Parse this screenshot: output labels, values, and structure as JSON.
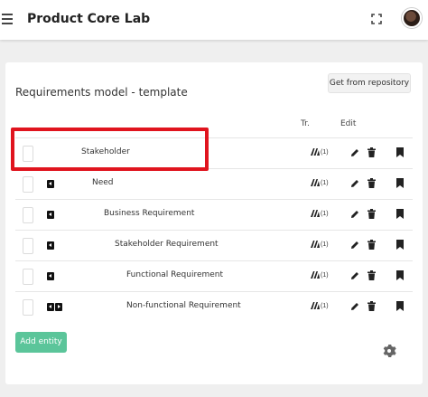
{
  "header": {
    "app_title": "Product Core Lab",
    "menu_icon": "hamburger-menu-icon",
    "fullscreen_icon": "fullscreen-icon",
    "avatar": "user-avatar"
  },
  "card": {
    "title": "Requirements model - template",
    "repo_button_label": "Get from repository",
    "columns": {
      "trace": "Tr.",
      "edit": "Edit"
    },
    "rows": [
      {
        "label": "Stakeholder",
        "trace_count": "(1)",
        "arrows": []
      },
      {
        "label": "Need",
        "trace_count": "(1)",
        "arrows": [
          "left"
        ]
      },
      {
        "label": "Business Requirement",
        "trace_count": "(1)",
        "arrows": [
          "left"
        ]
      },
      {
        "label": "Stakeholder Requirement",
        "trace_count": "(1)",
        "arrows": [
          "left"
        ]
      },
      {
        "label": "Functional Requirement",
        "trace_count": "(1)",
        "arrows": [
          "left"
        ]
      },
      {
        "label": "Non-functional Requirement",
        "trace_count": "(1)",
        "arrows": [
          "left",
          "right"
        ]
      }
    ],
    "add_button_label": "Add entity",
    "settings_icon": "gear-icon"
  },
  "colors": {
    "accent_green": "#5bc59a",
    "highlight_red": "#e0141e",
    "background": "#efefef"
  }
}
